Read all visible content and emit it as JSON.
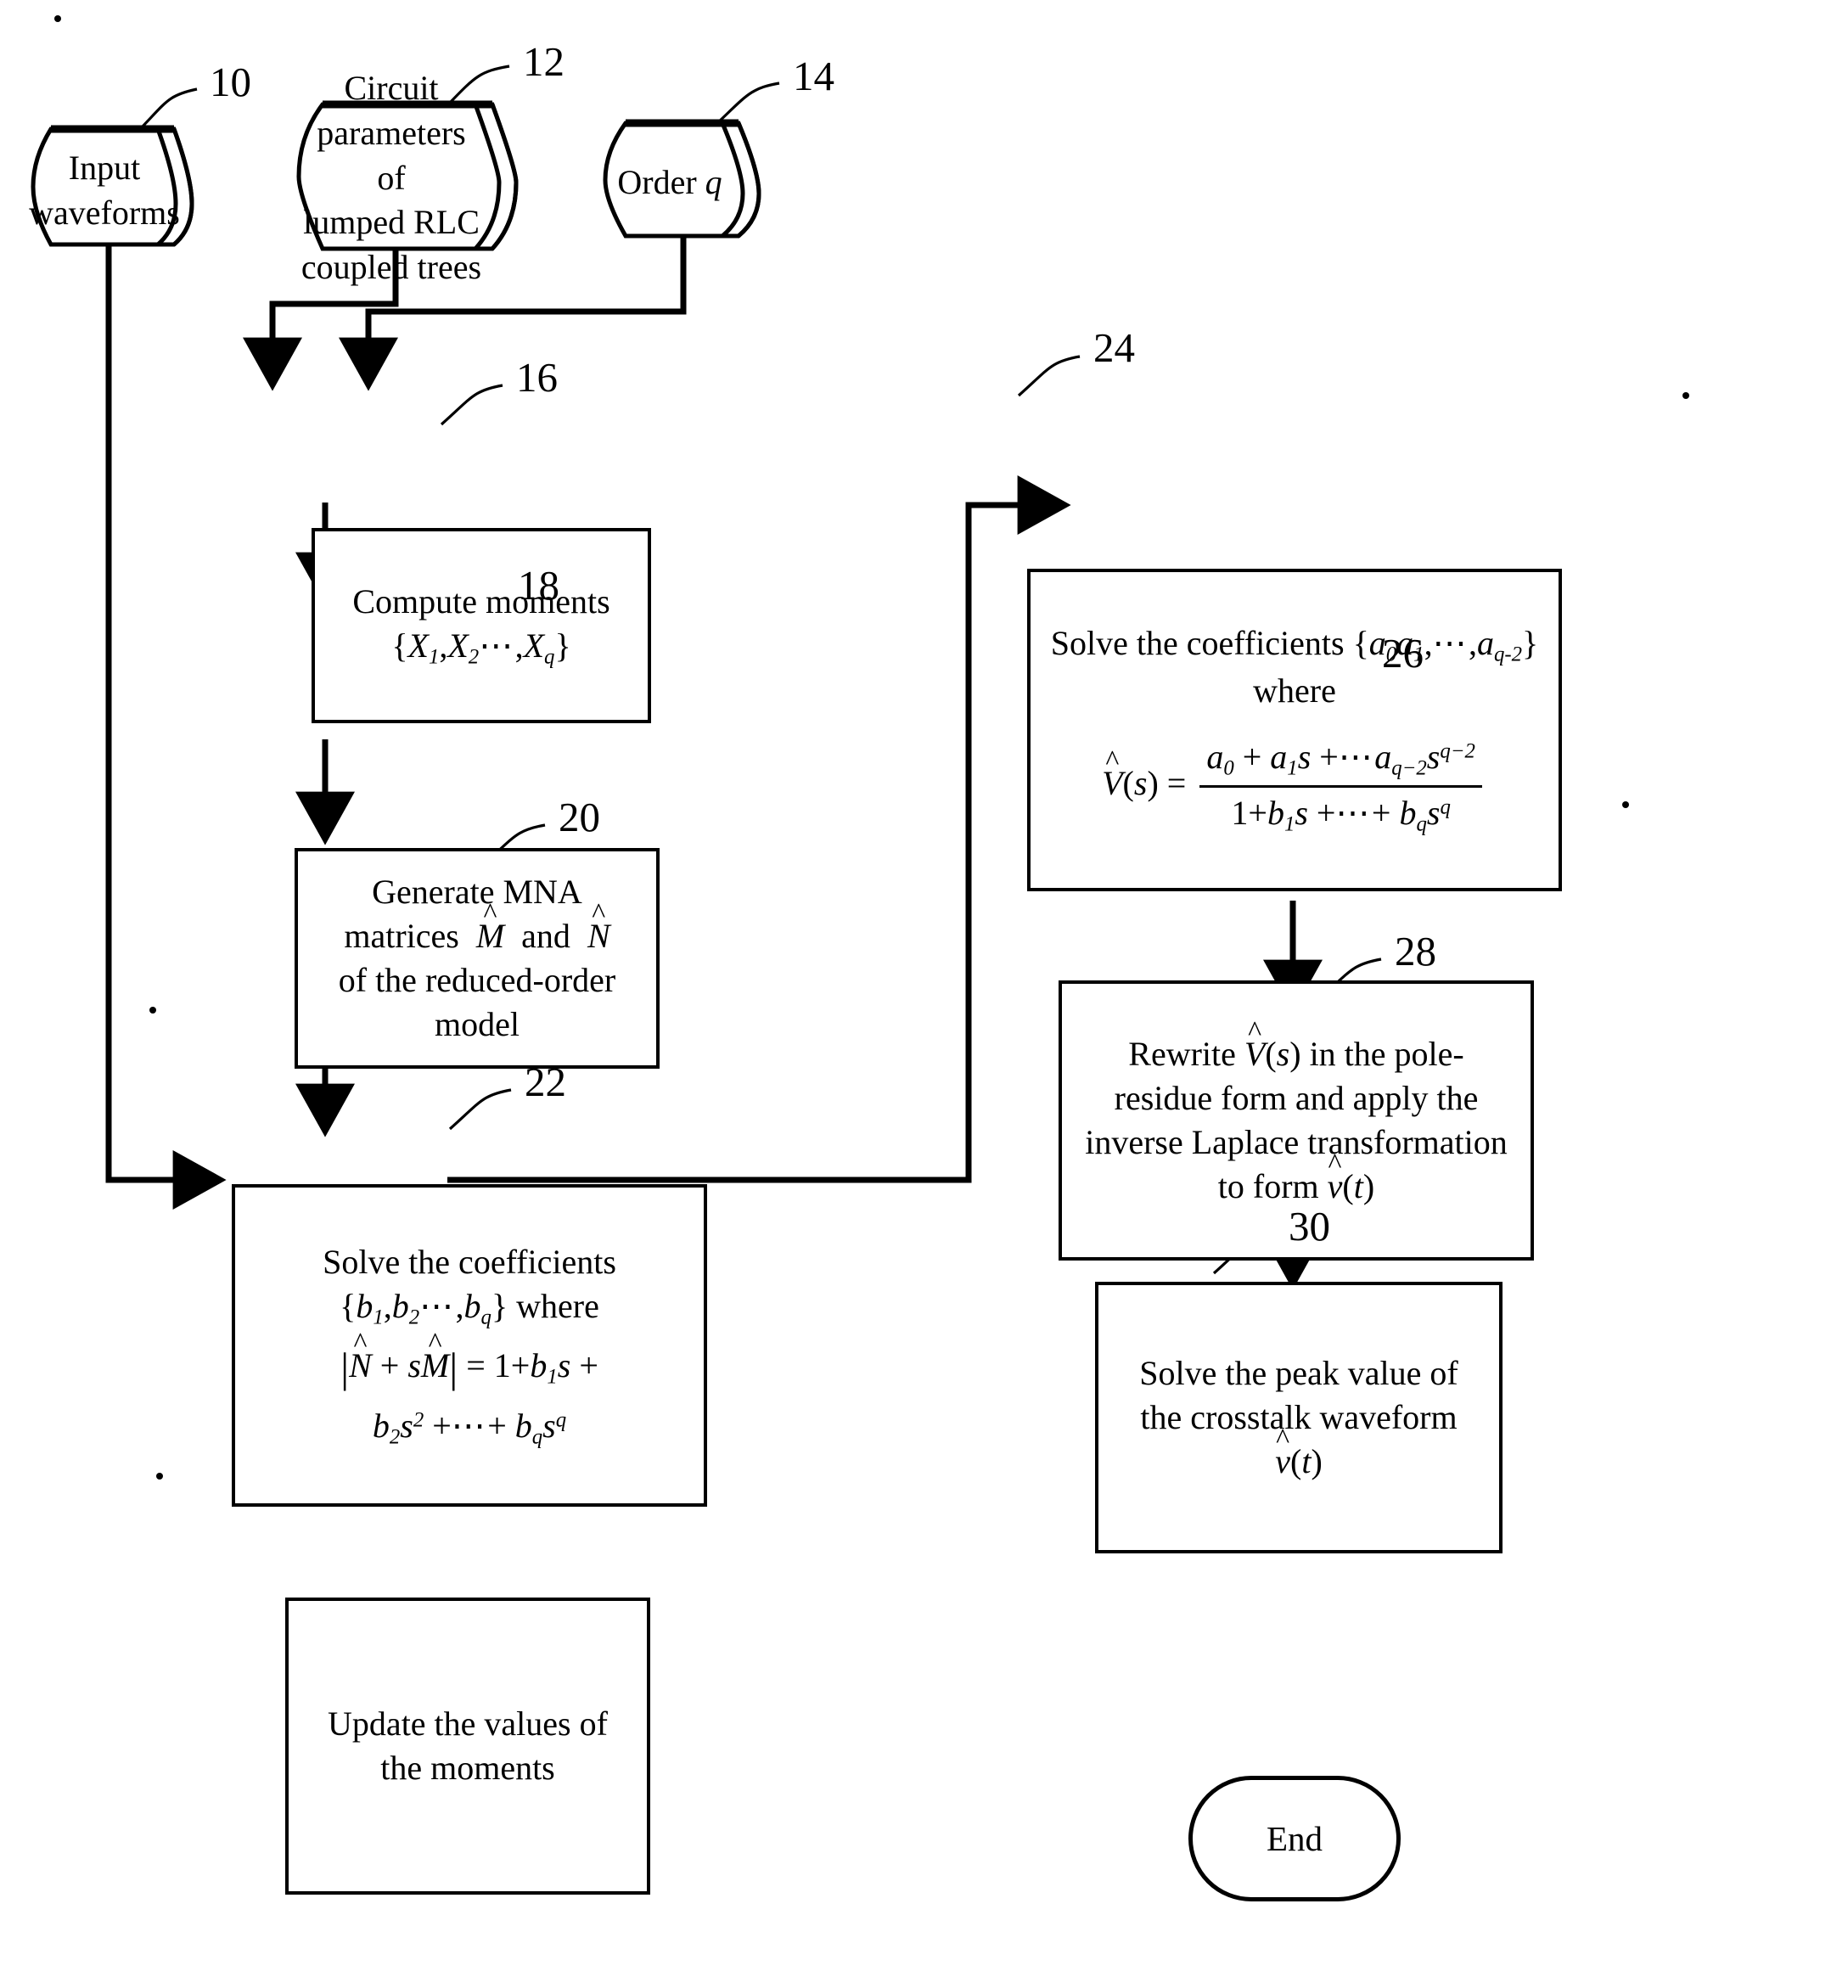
{
  "figure": {
    "type": "patent-flowchart",
    "background": "#ffffff",
    "line_color": "#000000"
  },
  "inputs": [
    {
      "ref": "10",
      "name": "input-waveforms",
      "shape": "cylinder",
      "lines": [
        "Input",
        "waveforms"
      ]
    },
    {
      "ref": "12",
      "name": "circuit-parameters",
      "shape": "cylinder",
      "lines": [
        "Circuit",
        "parameters of",
        "lumped RLC",
        "coupled trees"
      ]
    },
    {
      "ref": "14",
      "name": "order-q",
      "shape": "cylinder",
      "lines": [
        "Order q"
      ]
    }
  ],
  "steps": [
    {
      "ref": "16",
      "name": "compute-moments",
      "title": "Compute moments",
      "formula": "{X1,X2···,Xq}"
    },
    {
      "ref": "18",
      "name": "generate-mna-matrices",
      "lines": [
        "Generate MNA",
        "matrices M̂ and N̂",
        "of the reduced-order",
        "model"
      ]
    },
    {
      "ref": "20",
      "name": "solve-coefficients-b",
      "title": "Solve the coefficients",
      "set": "{b1,b2···,bq} where",
      "formula": "|N̂ + sM̂| = 1 + b1s + b2s² + ··· + bqs^q"
    },
    {
      "ref": "22",
      "name": "update-moments",
      "lines": [
        "Update the values of",
        "the moments"
      ]
    },
    {
      "ref": "24",
      "name": "solve-coefficients-a",
      "title": "Solve the coefficients {a0a1,···,aq-2}",
      "title2": "where",
      "formula": "V̂(s) = (a0 + a1s + ···aq-2 s^(q-2)) / (1 + b1s + ··· + bq s^q)"
    },
    {
      "ref": "26",
      "name": "rewrite-pole-residue",
      "lines": [
        "Rewrite V̂(s) in the pole-",
        "residue form and apply the",
        "inverse Laplace transformation",
        "to form v̂(t)"
      ]
    },
    {
      "ref": "28",
      "name": "solve-peak-value",
      "lines": [
        "Solve the peak value of",
        "the crosstalk waveform",
        "v̂(t)"
      ]
    },
    {
      "ref": "30",
      "name": "end-terminator",
      "label": "End",
      "shape": "stadium"
    }
  ],
  "labels": {
    "input_l1": "Input",
    "input_l2": "waveforms",
    "circ_l1": "Circuit",
    "circ_l2": "parameters of",
    "circ_l3": "lumped RLC",
    "circ_l4": "coupled trees",
    "order_word": "Order",
    "order_var": "q",
    "compute_title": "Compute moments",
    "mna_l1": "Generate MNA",
    "mna_l2a": "matrices",
    "mna_l2b": "and",
    "mna_l3": "of the reduced-order",
    "mna_l4": "model",
    "solve_b_title": "Solve the coefficients",
    "solve_b_where": "where",
    "update_l1": "Update the values of",
    "update_l2": "the moments",
    "solve_a_title": "Solve the coefficients",
    "solve_a_where": "where",
    "rewrite_l1a": "Rewrite",
    "rewrite_l1b": "in the pole-",
    "rewrite_l2": "residue form and apply the",
    "rewrite_l3": "inverse Laplace transformation",
    "rewrite_l4a": "to form",
    "peak_l1": "Solve the peak value of",
    "peak_l2": "the crosstalk waveform",
    "end_label": "End"
  },
  "refs": {
    "r10": "10",
    "r12": "12",
    "r14": "14",
    "r16": "16",
    "r18": "18",
    "r20": "20",
    "r22": "22",
    "r24": "24",
    "r26": "26",
    "r28": "28",
    "r30": "30"
  }
}
